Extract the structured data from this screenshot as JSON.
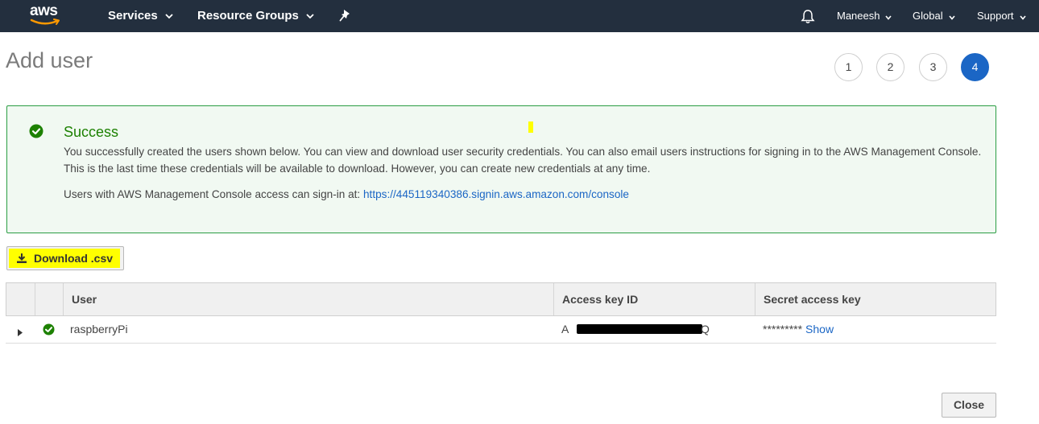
{
  "nav": {
    "logo_text": "aws",
    "services": "Services",
    "resource_groups": "Resource Groups",
    "user": "Maneesh",
    "region": "Global",
    "support": "Support"
  },
  "page": {
    "title": "Add user",
    "steps": [
      "1",
      "2",
      "3",
      "4"
    ],
    "active_step": "4"
  },
  "success": {
    "title": "Success",
    "message": "You successfully created the users shown below. You can view and download user security credentials. You can also email users instructions for signing in to the AWS Management Console. This is the last time these credentials will be available to download. However, you can create new credentials at any time.",
    "login_prefix": "Users with AWS Management Console access can sign-in at: ",
    "login_url": "https://445119340386.signin.aws.amazon.com/console"
  },
  "download_label": "Download .csv",
  "table": {
    "headers": [
      "User",
      "Access key ID",
      "Secret access key"
    ],
    "rows": [
      {
        "user": "raspberryPi",
        "access_key_start": "A",
        "access_key_end": "Q",
        "secret_masked": "*********",
        "show_label": "Show"
      }
    ]
  },
  "close_label": "Close",
  "colors": {
    "nav_bg": "#232f3e",
    "success_green": "#1d8102",
    "link_blue": "#1b66c5",
    "highlight": "#ffff00"
  }
}
